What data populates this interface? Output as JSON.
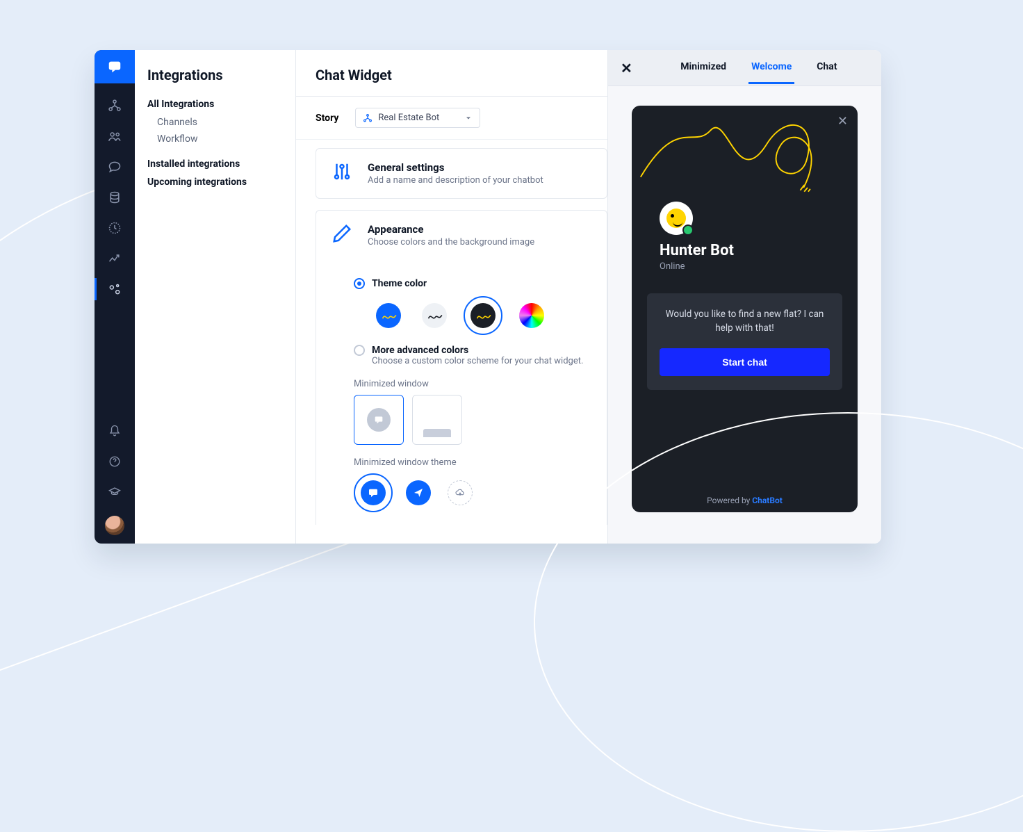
{
  "sidebar": {
    "title": "Integrations",
    "allIntegrations": "All Integrations",
    "channels": "Channels",
    "workflow": "Workflow",
    "installed": "Installed integrations",
    "upcoming": "Upcoming integrations"
  },
  "main": {
    "title": "Chat Widget",
    "storyLabel": "Story",
    "storyValue": "Real Estate Bot",
    "general": {
      "title": "General settings",
      "desc": "Add a name and description of your chatbot"
    },
    "appearance": {
      "title": "Appearance",
      "desc": "Choose colors and the background image",
      "themeColorLabel": "Theme color",
      "moreAdvancedLabel": "More advanced colors",
      "moreAdvancedDesc": "Choose a custom color scheme for your chat widget.",
      "minWindowLabel": "Minimized window",
      "minWindowThemeLabel": "Minimized window theme"
    }
  },
  "preview": {
    "tabs": {
      "minimized": "Minimized",
      "welcome": "Welcome",
      "chat": "Chat"
    },
    "bot": {
      "name": "Hunter Bot",
      "status": "Online",
      "message": "Would you like to find a new flat? I can help with that!",
      "cta": "Start chat",
      "poweredPrefix": "Powered by ",
      "poweredBrand": "ChatBot"
    }
  }
}
